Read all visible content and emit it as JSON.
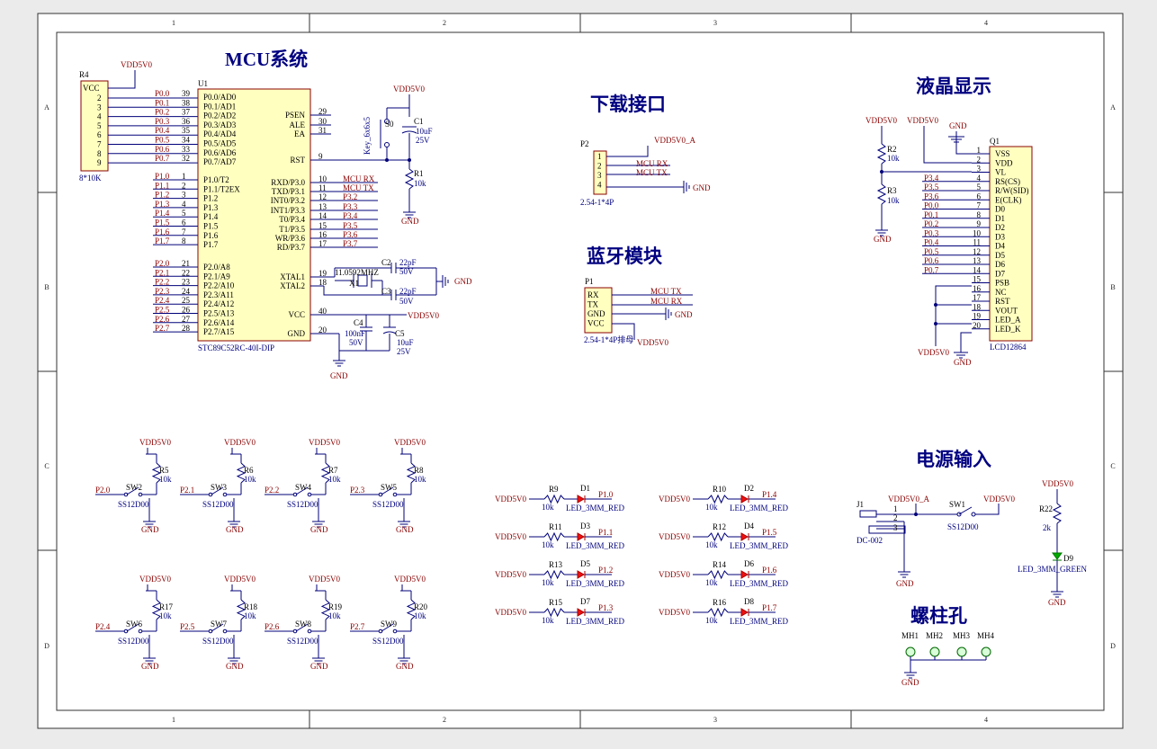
{
  "frame": {
    "cols": [
      "1",
      "2",
      "3",
      "4"
    ],
    "rows": [
      "A",
      "B",
      "C",
      "D"
    ]
  },
  "sections": {
    "mcu": "MCU系统",
    "download": "下载接口",
    "bluetooth": "蓝牙模块",
    "lcd": "液晶显示",
    "power": "电源输入",
    "screw": "螺柱孔"
  },
  "mcu": {
    "ref": "U1",
    "part": "STC89C52RC-40I-DIP",
    "left_pins": [
      {
        "net": "P0.0",
        "num": "39",
        "name": "P0.0/AD0"
      },
      {
        "net": "P0.1",
        "num": "38",
        "name": "P0.1/AD1"
      },
      {
        "net": "P0.2",
        "num": "37",
        "name": "P0.2/AD2"
      },
      {
        "net": "P0.3",
        "num": "36",
        "name": "P0.3/AD3"
      },
      {
        "net": "P0.4",
        "num": "35",
        "name": "P0.4/AD4"
      },
      {
        "net": "P0.5",
        "num": "34",
        "name": "P0.5/AD5"
      },
      {
        "net": "P0.6",
        "num": "33",
        "name": "P0.6/AD6"
      },
      {
        "net": "P0.7",
        "num": "32",
        "name": "P0.7/AD7"
      },
      {
        "net": "P1.0",
        "num": "1",
        "name": "P1.0/T2"
      },
      {
        "net": "P1.1",
        "num": "2",
        "name": "P1.1/T2EX"
      },
      {
        "net": "P1.2",
        "num": "3",
        "name": "P1.2"
      },
      {
        "net": "P1.3",
        "num": "4",
        "name": "P1.3"
      },
      {
        "net": "P1.4",
        "num": "5",
        "name": "P1.4"
      },
      {
        "net": "P1.5",
        "num": "6",
        "name": "P1.5"
      },
      {
        "net": "P1.6",
        "num": "7",
        "name": "P1.6"
      },
      {
        "net": "P1.7",
        "num": "8",
        "name": "P1.7"
      },
      {
        "net": "P2.0",
        "num": "21",
        "name": "P2.0/A8"
      },
      {
        "net": "P2.1",
        "num": "22",
        "name": "P2.1/A9"
      },
      {
        "net": "P2.2",
        "num": "23",
        "name": "P2.2/A10"
      },
      {
        "net": "P2.3",
        "num": "24",
        "name": "P2.3/A11"
      },
      {
        "net": "P2.4",
        "num": "25",
        "name": "P2.4/A12"
      },
      {
        "net": "P2.5",
        "num": "26",
        "name": "P2.5/A13"
      },
      {
        "net": "P2.6",
        "num": "27",
        "name": "P2.6/A14"
      },
      {
        "net": "P2.7",
        "num": "28",
        "name": "P2.7/A15"
      }
    ],
    "right_pins": [
      {
        "num": "29",
        "name": "PSEN",
        "net": ""
      },
      {
        "num": "30",
        "name": "ALE",
        "net": ""
      },
      {
        "num": "31",
        "name": "EA",
        "net": ""
      },
      {
        "num": "9",
        "name": "RST",
        "net": ""
      },
      {
        "num": "10",
        "name": "RXD/P3.0",
        "net": "MCU RX"
      },
      {
        "num": "11",
        "name": "TXD/P3.1",
        "net": "MCU TX"
      },
      {
        "num": "12",
        "name": "INT0/P3.2",
        "net": "P3.2"
      },
      {
        "num": "13",
        "name": "INT1/P3.3",
        "net": "P3.3"
      },
      {
        "num": "14",
        "name": "T0/P3.4",
        "net": "P3.4"
      },
      {
        "num": "15",
        "name": "T1/P3.5",
        "net": "P3.5"
      },
      {
        "num": "16",
        "name": "WR/P3.6",
        "net": "P3.6"
      },
      {
        "num": "17",
        "name": "RD/P3.7",
        "net": "P3.7"
      },
      {
        "num": "19",
        "name": "XTAL1",
        "net": ""
      },
      {
        "num": "18",
        "name": "XTAL2",
        "net": ""
      },
      {
        "num": "40",
        "name": "VCC",
        "net": ""
      },
      {
        "num": "20",
        "name": "GND",
        "net": ""
      }
    ]
  },
  "rpack": {
    "ref": "R4",
    "part": "8*10K",
    "vcc": "VCC",
    "pins": [
      "2",
      "3",
      "4",
      "5",
      "6",
      "7",
      "8",
      "9"
    ]
  },
  "labels": {
    "vdd": "VDD5V0",
    "vdd_a": "VDD5V0_A",
    "gnd": "GND",
    "mcu_rx": "MCU RX",
    "mcu_tx": "MCU TX"
  },
  "reset": {
    "sw": "S0",
    "sw_part": "Key_6x6x5",
    "c_ref": "C1",
    "c_val": "10uF",
    "c_v": "25V",
    "r_ref": "R1",
    "r_val": "10k"
  },
  "crystal": {
    "freq": "11.0592MHZ",
    "ref": "X1",
    "c2_ref": "C2",
    "c2_val": "22pF",
    "c2_v": "50V",
    "c3_ref": "C3",
    "c3_val": "22pF",
    "c3_v": "50V"
  },
  "decoup": {
    "c4_ref": "C4",
    "c4_val": "100nF",
    "c4_v": "50V",
    "c5_ref": "C5",
    "c5_val": "10uF",
    "c5_v": "25V"
  },
  "p2": {
    "ref": "P2",
    "part": "2.54-1*4P",
    "pins": [
      "1",
      "2",
      "3",
      "4"
    ]
  },
  "p1": {
    "ref": "P1",
    "part": "2.54-1*4P排母",
    "pins": [
      "RX",
      "TX",
      "GND",
      "VCC"
    ]
  },
  "lcd": {
    "ref": "Q1",
    "part": "LCD12864",
    "r2_ref": "R2",
    "r2_val": "10k",
    "r3_ref": "R3",
    "r3_val": "10k",
    "pins": [
      {
        "num": "1",
        "name": "VSS",
        "net": ""
      },
      {
        "num": "2",
        "name": "VDD",
        "net": ""
      },
      {
        "num": "3",
        "name": "VL",
        "net": ""
      },
      {
        "num": "4",
        "name": "RS(CS)",
        "net": "P3.4"
      },
      {
        "num": "5",
        "name": "R/W(SID)",
        "net": "P3.5"
      },
      {
        "num": "6",
        "name": "E(CLK)",
        "net": "P3.6"
      },
      {
        "num": "7",
        "name": "D0",
        "net": "P0.0"
      },
      {
        "num": "8",
        "name": "D1",
        "net": "P0.1"
      },
      {
        "num": "9",
        "name": "D2",
        "net": "P0.2"
      },
      {
        "num": "10",
        "name": "D3",
        "net": "P0.3"
      },
      {
        "num": "11",
        "name": "D4",
        "net": "P0.4"
      },
      {
        "num": "12",
        "name": "D5",
        "net": "P0.5"
      },
      {
        "num": "13",
        "name": "D6",
        "net": "P0.6"
      },
      {
        "num": "14",
        "name": "D7",
        "net": "P0.7"
      },
      {
        "num": "15",
        "name": "PSB",
        "net": ""
      },
      {
        "num": "16",
        "name": "NC",
        "net": ""
      },
      {
        "num": "17",
        "name": "RST",
        "net": ""
      },
      {
        "num": "18",
        "name": "VOUT",
        "net": ""
      },
      {
        "num": "19",
        "name": "LED_A",
        "net": ""
      },
      {
        "num": "20",
        "name": "LED_K",
        "net": ""
      }
    ]
  },
  "switch_part": "SS12D00",
  "keys": [
    {
      "sw": "SW2",
      "r": "R5",
      "rv": "10k",
      "net": "P2.0"
    },
    {
      "sw": "SW3",
      "r": "R6",
      "rv": "10k",
      "net": "P2.1"
    },
    {
      "sw": "SW4",
      "r": "R7",
      "rv": "10k",
      "net": "P2.2"
    },
    {
      "sw": "SW5",
      "r": "R8",
      "rv": "10k",
      "net": "P2.3"
    },
    {
      "sw": "SW6",
      "r": "R17",
      "rv": "10k",
      "net": "P2.4"
    },
    {
      "sw": "SW7",
      "r": "R18",
      "rv": "10k",
      "net": "P2.5"
    },
    {
      "sw": "SW8",
      "r": "R19",
      "rv": "10k",
      "net": "P2.6"
    },
    {
      "sw": "SW9",
      "r": "R20",
      "rv": "10k",
      "net": "P2.7"
    }
  ],
  "led_part": "LED_3MM_RED",
  "leds": [
    {
      "r": "R9",
      "rv": "10k",
      "d": "D1",
      "net": "P1.0"
    },
    {
      "r": "R11",
      "rv": "10k",
      "d": "D3",
      "net": "P1.1"
    },
    {
      "r": "R13",
      "rv": "10k",
      "d": "D5",
      "net": "P1.2"
    },
    {
      "r": "R15",
      "rv": "10k",
      "d": "D7",
      "net": "P1.3"
    },
    {
      "r": "R10",
      "rv": "10k",
      "d": "D2",
      "net": "P1.4"
    },
    {
      "r": "R12",
      "rv": "10k",
      "d": "D4",
      "net": "P1.5"
    },
    {
      "r": "R14",
      "rv": "10k",
      "d": "D6",
      "net": "P1.6"
    },
    {
      "r": "R16",
      "rv": "10k",
      "d": "D8",
      "net": "P1.7"
    }
  ],
  "power": {
    "j_ref": "J1",
    "j_part": "DC-002",
    "j_pins": [
      "1",
      "2",
      "3"
    ],
    "sw": "SW1",
    "r_ref": "R22",
    "r_val": "2k",
    "d_ref": "D9",
    "d_part": "LED_3MM_GREEN"
  },
  "holes": [
    "MH1",
    "MH2",
    "MH3",
    "MH4"
  ]
}
